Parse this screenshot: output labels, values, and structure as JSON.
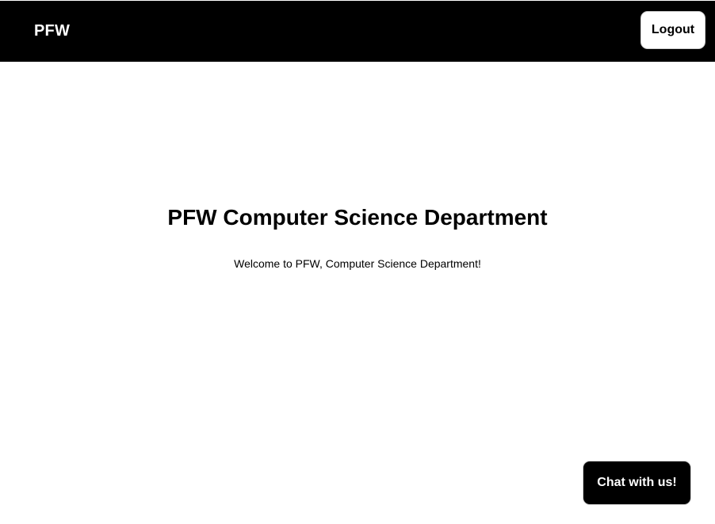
{
  "navbar": {
    "brand": "PFW",
    "logout_label": "Logout"
  },
  "main": {
    "title": "PFW Computer Science Department",
    "welcome": "Welcome to PFW, Computer Science Department!"
  },
  "chat": {
    "label": "Chat with us!"
  }
}
